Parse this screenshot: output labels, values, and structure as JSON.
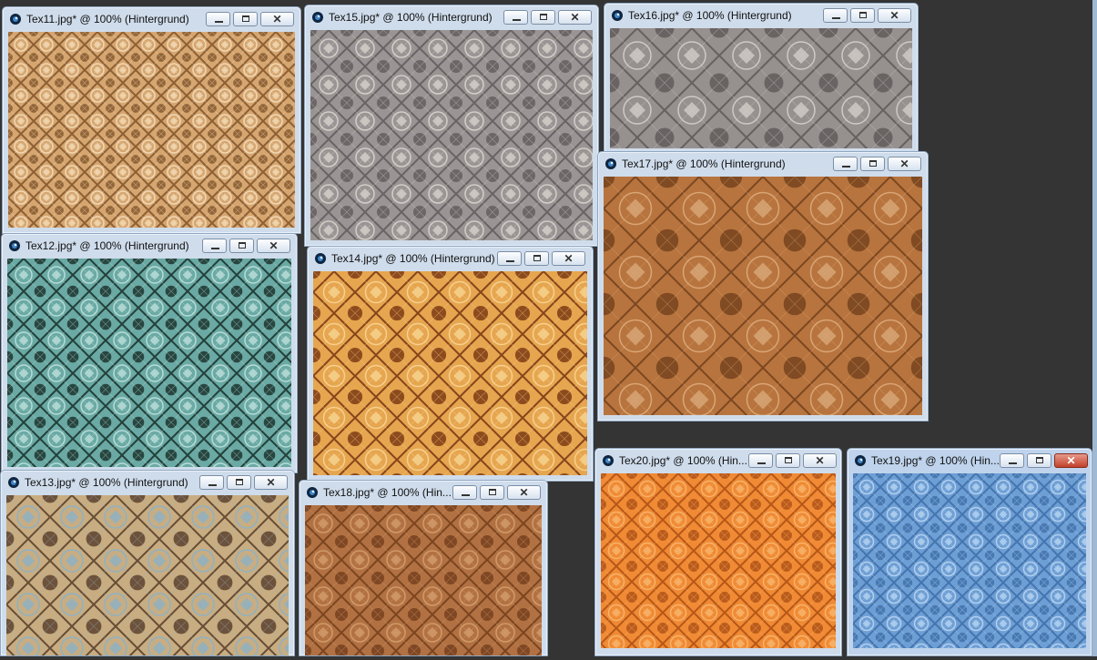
{
  "workspace": {
    "background": "#343434"
  },
  "windows": {
    "tex11": {
      "title": "Tex11.jpg* @ 100% (Hintergrund)",
      "base": "#d6a670",
      "dark": "#7a4f25",
      "light": "#f1d8b4"
    },
    "tex15": {
      "title": "Tex15.jpg* @ 100% (Hintergrund)",
      "base": "#9a9594",
      "dark": "#5c5656",
      "light": "#d2cec8"
    },
    "tex16": {
      "title": "Tex16.jpg* @ 100% (Hintergrund)",
      "base": "#96908e",
      "dark": "#5a5454",
      "light": "#cfcac4"
    },
    "tex12": {
      "title": "Tex12.jpg* @ 100% (Hintergrund)",
      "base": "#6aa9a4",
      "dark": "#11251f",
      "light": "#b7dcd7"
    },
    "tex14": {
      "title": "Tex14.jpg* @ 100% (Hintergrund)",
      "base": "#e6a54f",
      "dark": "#6e2d0c",
      "light": "#f6d18d"
    },
    "tex17": {
      "title": "Tex17.jpg* @ 100% (Hintergrund)",
      "base": "#b8743e",
      "dark": "#6d3c18",
      "light": "#d9a676"
    },
    "tex13": {
      "title": "Tex13.jpg* @ 100% (Hintergrund)",
      "base": "#c8ad82",
      "dark": "#4f3422",
      "light": "#8fb1c2"
    },
    "tex18": {
      "title": "Tex18.jpg* @ 100% (Hin...",
      "base": "#b27142",
      "dark": "#6d3918",
      "light": "#d19a69"
    },
    "tex20": {
      "title": "Tex20.jpg* @ 100% (Hin...",
      "base": "#f08a34",
      "dark": "#a84a12",
      "light": "#f7b36a"
    },
    "tex19": {
      "title": "Tex19.jpg* @ 100% (Hin...",
      "base": "#6d9ed4",
      "dark": "#3a6aa5",
      "light": "#b2d0ef"
    }
  },
  "labels": {
    "minimize": "—",
    "maximize": "□",
    "close": "✕"
  }
}
